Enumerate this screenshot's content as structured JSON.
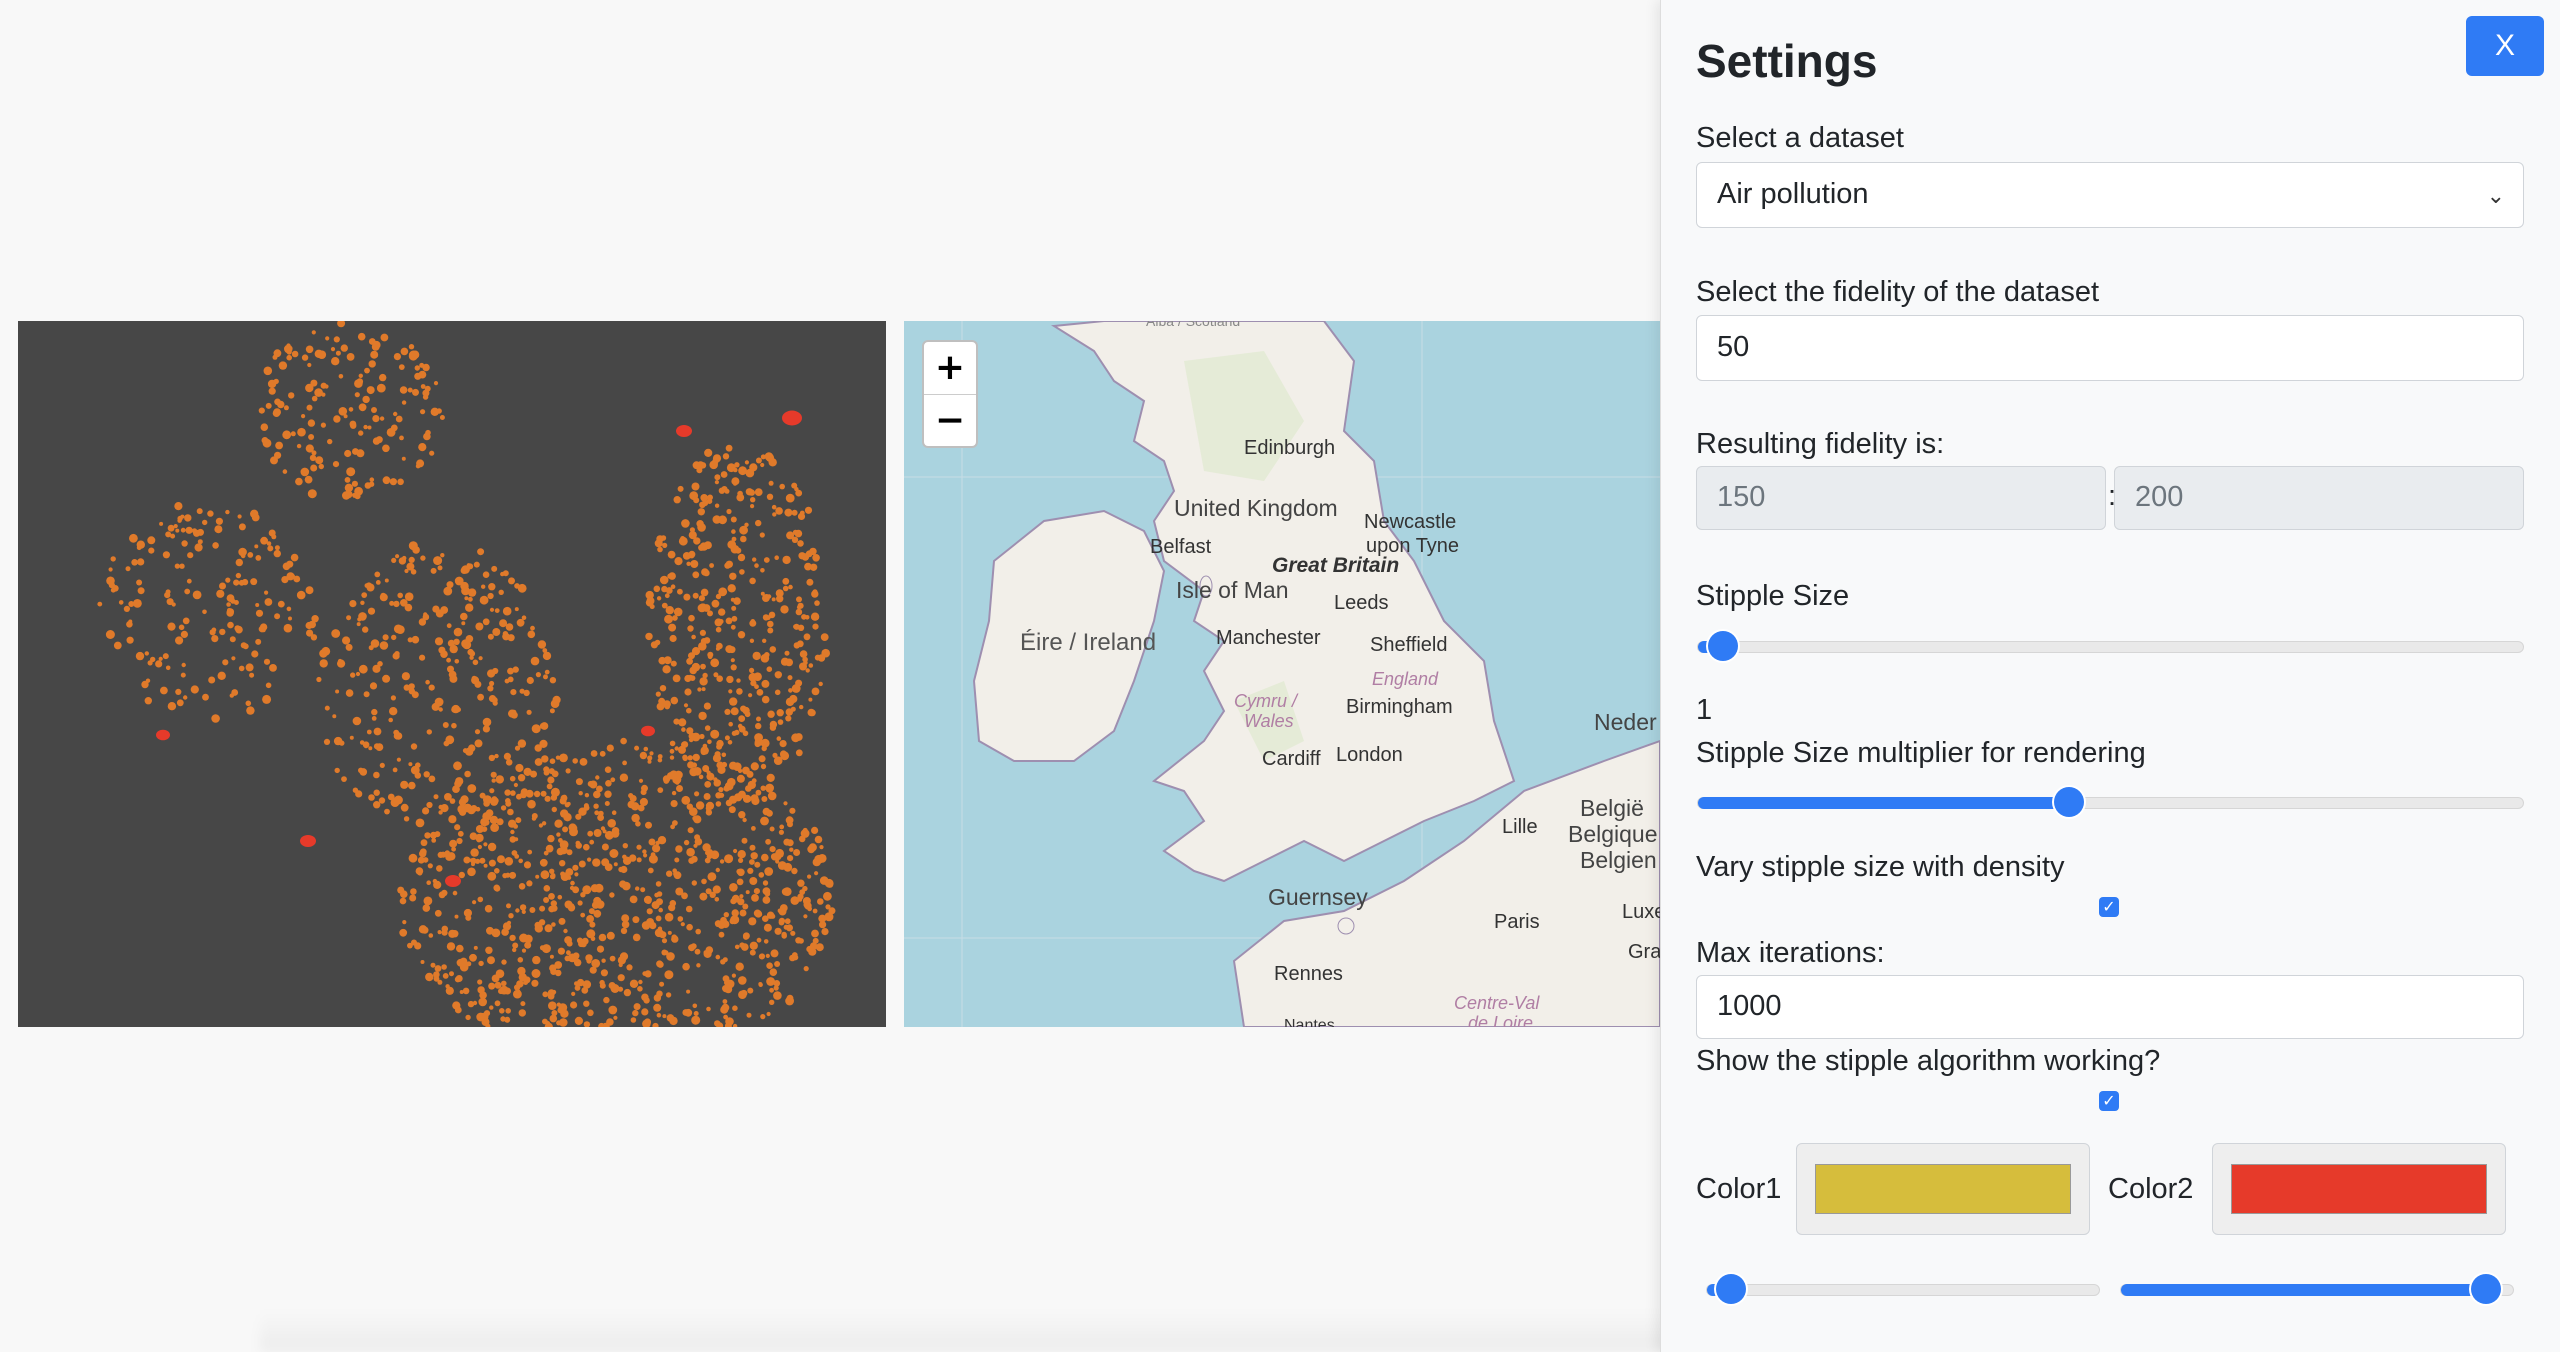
{
  "settings": {
    "title": "Settings",
    "close_label": "X",
    "dataset_label": "Select a dataset",
    "dataset_value": "Air pollution",
    "fidelity_label": "Select the fidelity of the dataset",
    "fidelity_value": "50",
    "resulting_label": "Resulting fidelity is:",
    "resulting_a": "150",
    "resulting_sep": ":",
    "resulting_b": "200",
    "stipple_size_label": "Stipple Size",
    "stipple_size_fraction": 0.03,
    "stipple_size_value": "1",
    "multiplier_label": "Stipple Size multiplier for rendering",
    "multiplier_fraction": 0.45,
    "vary_label": "Vary stipple size with density",
    "vary_checked": true,
    "max_iter_label": "Max iterations:",
    "max_iter_value": "1000",
    "show_algo_label": "Show the stipple algorithm working?",
    "show_algo_checked": true,
    "color1_label": "Color1",
    "color1": "#d6bd3c",
    "color2_label": "Color2",
    "color2": "#e63a2a",
    "color1_slider_fraction": 0.06,
    "color2_slider_fraction": 0.93
  },
  "map": {
    "zoom_in": "+",
    "zoom_out": "−",
    "labels": {
      "scotland": "Alba / Scotland",
      "edinburgh": "Edinburgh",
      "uk": "United Kingdom",
      "newcastle1": "Newcastle",
      "newcastle2": "upon Tyne",
      "belfast": "Belfast",
      "great_britain": "Great Britain",
      "isle_of_man": "Isle of Man",
      "leeds": "Leeds",
      "eire": "Éire / Ireland",
      "manchester": "Manchester",
      "sheffield": "Sheffield",
      "england": "England",
      "cymru1": "Cymru /",
      "cymru2": "Wales",
      "birmingham": "Birmingham",
      "cardiff": "Cardiff",
      "london": "London",
      "guernsey": "Guernsey",
      "lille": "Lille",
      "belgie1": "België",
      "belgie2": "Belgique",
      "belgie3": "Belgien",
      "neder": "Neder",
      "paris": "Paris",
      "rennes": "Rennes",
      "centre1": "Centre-Val",
      "centre2": "de Loire",
      "nantes": "Nantes",
      "luxe": "Luxe",
      "gran": "Gran"
    },
    "colors": {
      "sea": "#aad3df",
      "land": "#f2efe9",
      "border": "#9e8fb0"
    }
  },
  "stipple": {
    "background": "#474747",
    "dot_color": "#e07a2a",
    "highlight_color": "#e63a2a"
  }
}
